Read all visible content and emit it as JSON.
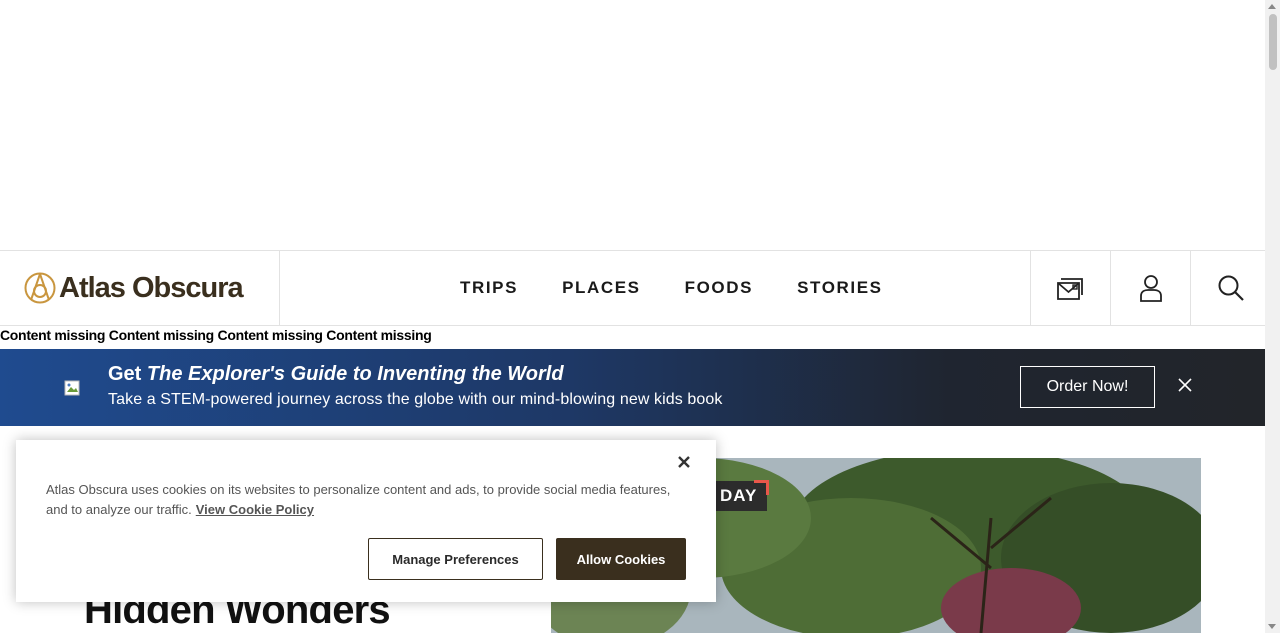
{
  "header": {
    "logo_text": "Atlas Obscura",
    "nav": [
      {
        "label": "TRIPS"
      },
      {
        "label": "PLACES"
      },
      {
        "label": "FOODS"
      },
      {
        "label": "STORIES"
      }
    ],
    "icons": [
      "newsletter-icon",
      "account-icon",
      "search-icon"
    ]
  },
  "missing_text": "Content missing Content missing Content missing Content missing",
  "promo": {
    "title_prefix": "Get ",
    "title_italic": "The Explorer's Guide to Inventing the World",
    "subtitle": "Take a STEM-powered journey across the globe with our mind-blowing new kids book",
    "button_label": "Order Now!"
  },
  "hero": {
    "title": "Hidden Wonders",
    "badge": "DAY"
  },
  "cookie": {
    "text": "Atlas Obscura uses cookies on its websites to personalize content and ads, to provide social media features, and to analyze our traffic.",
    "link_label": "View Cookie Policy",
    "manage_label": "Manage Preferences",
    "allow_label": "Allow Cookies"
  },
  "colors": {
    "brand_brown": "#3a2f1e",
    "promo_blue": "#1f4b8f",
    "badge_accent": "#e8574a"
  }
}
